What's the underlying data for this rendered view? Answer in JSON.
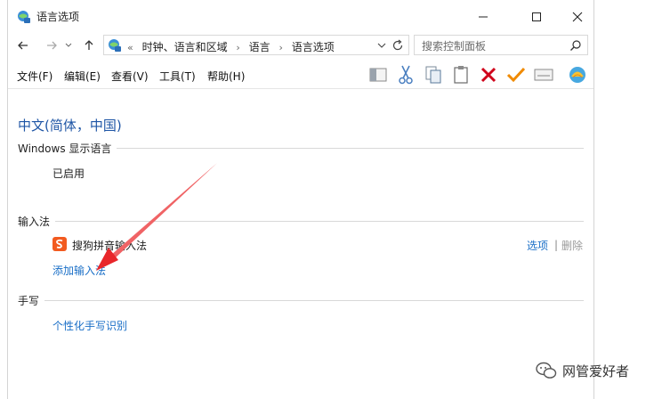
{
  "window": {
    "title": "语言选项"
  },
  "address": {
    "crumbs": [
      "«",
      "时钟、语言和区域",
      "›",
      "语言",
      "›",
      "语言选项"
    ]
  },
  "search": {
    "placeholder": "搜索控制面板"
  },
  "menu": {
    "items": [
      "文件(F)",
      "编辑(E)",
      "查看(V)",
      "工具(T)",
      "帮助(H)"
    ]
  },
  "content": {
    "language_title": "中文(简体，中国)",
    "display_section": {
      "label": "Windows 显示语言",
      "status": "已启用"
    },
    "input_section": {
      "label": "输入法",
      "ime_name": "搜狗拼音输入法",
      "options_link": "选项",
      "separator": "|",
      "remove_link": "删除",
      "add_link": "添加输入法"
    },
    "handwriting_section": {
      "label": "手写",
      "personalize_link": "个性化手写识别"
    }
  },
  "watermark": {
    "text": "网管爱好者"
  },
  "icons": {
    "app": "language-options-icon",
    "back": "back-arrow-icon",
    "forward": "forward-arrow-icon",
    "up": "up-arrow-icon",
    "refresh": "refresh-icon",
    "search": "search-icon",
    "toolbar": [
      "panel-icon",
      "cut-icon",
      "copy-icon",
      "paste-icon",
      "delete-icon",
      "check-icon",
      "keyboard-icon",
      "shell-icon"
    ]
  },
  "colors": {
    "link": "#1a6fc7",
    "title": "#1e55a5",
    "annotation_arrow": "#e8262a",
    "delete": "#d0021b",
    "check": "#f08a00"
  }
}
